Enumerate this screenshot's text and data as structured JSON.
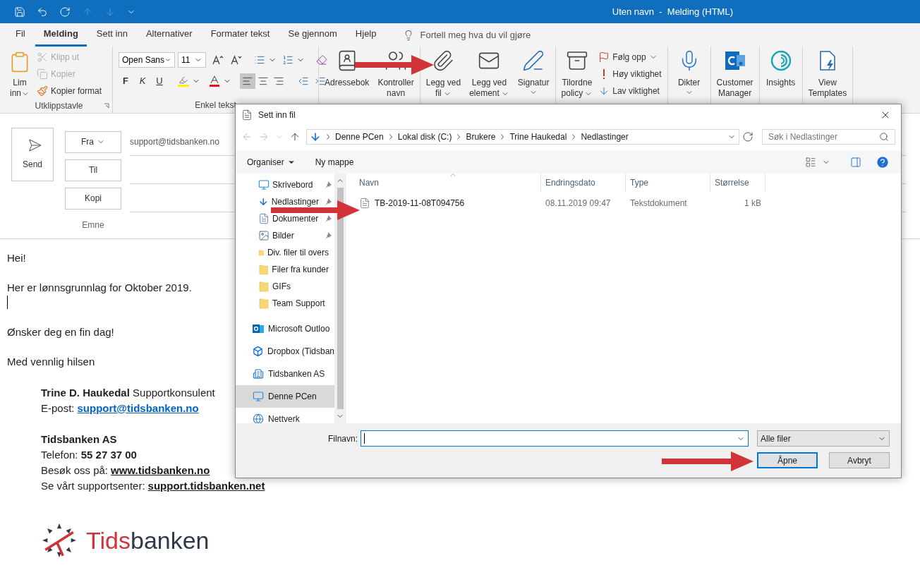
{
  "window": {
    "title": "Uten navn  -  Melding (HTML)"
  },
  "tabs": [
    {
      "label": "Fil",
      "selected": false
    },
    {
      "label": "Melding",
      "selected": true
    },
    {
      "label": "Sett inn",
      "selected": false
    },
    {
      "label": "Alternativer",
      "selected": false
    },
    {
      "label": "Formater tekst",
      "selected": false
    },
    {
      "label": "Se gjennom",
      "selected": false
    },
    {
      "label": "Hjelp",
      "selected": false
    }
  ],
  "tell_me": {
    "placeholder": "Fortell meg hva du vil gjøre"
  },
  "ribbon": {
    "clipboard": {
      "label": "Utklippstavle",
      "paste": {
        "lines": [
          "Lim",
          "inn"
        ],
        "dropdown": true
      },
      "items": [
        {
          "kind": "cut",
          "label": "Klipp ut",
          "disabled": true
        },
        {
          "kind": "copy",
          "label": "Kopier",
          "disabled": true
        },
        {
          "kind": "format",
          "label": "Kopier format",
          "disabled": false
        }
      ]
    },
    "basic_text": {
      "label": "Enkel tekst",
      "font": "Open Sans",
      "size": "11",
      "styles": [
        "F",
        "K",
        "U"
      ],
      "alignments": [
        {
          "kind": "left",
          "selected": true
        },
        {
          "kind": "center",
          "selected": false
        },
        {
          "kind": "right",
          "selected": false
        }
      ]
    },
    "groups": [
      {
        "buttons": [
          {
            "kind": "address-book",
            "lines": [
              "Adressebok"
            ],
            "dropdown": false
          },
          {
            "kind": "check-names",
            "lines": [
              "Kontroller",
              "navn"
            ],
            "dropdown": false
          }
        ]
      },
      {
        "buttons": [
          {
            "kind": "attach-file",
            "lines": [
              "Legg ved",
              "fil"
            ],
            "dropdown": true
          },
          {
            "kind": "attach-item",
            "lines": [
              "Legg ved",
              "element"
            ],
            "dropdown": true
          },
          {
            "kind": "signature",
            "lines": [
              "Signatur"
            ],
            "dropdown": true
          }
        ]
      },
      {
        "buttons": [
          {
            "kind": "policy",
            "lines": [
              "Tilordne",
              "policy"
            ],
            "dropdown": true
          }
        ],
        "small": [
          {
            "kind": "flag",
            "label": "Følg opp",
            "dropdown": true
          },
          {
            "kind": "high",
            "label": "Høy viktighet",
            "dropdown": false
          },
          {
            "kind": "low",
            "label": "Lav viktighet",
            "dropdown": false
          }
        ]
      },
      {
        "buttons": [
          {
            "kind": "dictate",
            "lines": [
              "Dikter"
            ],
            "dropdown": true
          }
        ]
      },
      {
        "buttons": [
          {
            "kind": "customer-manager",
            "lines": [
              "Customer",
              "Manager"
            ],
            "dropdown": false
          }
        ]
      },
      {
        "buttons": [
          {
            "kind": "insights",
            "lines": [
              "Insights"
            ],
            "dropdown": false
          }
        ]
      },
      {
        "buttons": [
          {
            "kind": "templates",
            "lines": [
              "View",
              "Templates"
            ],
            "dropdown": false
          }
        ]
      }
    ]
  },
  "compose": {
    "send": "Send",
    "fields": [
      {
        "label": "Fra",
        "dropdown": true,
        "value": "support@tidsbanken.no"
      },
      {
        "label": "Til",
        "dropdown": false
      },
      {
        "label": "Kopi",
        "dropdown": false
      }
    ],
    "subject_label": "Emne"
  },
  "body": [
    {
      "kind": "text",
      "text": "Hei!"
    },
    {
      "kind": "blank"
    },
    {
      "kind": "text",
      "text": "Her er lønnsgrunnlag for Oktober 2019."
    },
    {
      "kind": "cursor"
    },
    {
      "kind": "blank"
    },
    {
      "kind": "text",
      "text": "Ønsker deg en fin dag!"
    },
    {
      "kind": "blank"
    },
    {
      "kind": "text",
      "text": "Med vennlig hilsen"
    }
  ],
  "signature": [
    {
      "kind": "text",
      "text": "**Trine D. Haukedal** Supportkonsulent"
    },
    {
      "kind": "link",
      "label": "E-post:",
      "link": "support@tidsbanken.no",
      "color": "#0563c1"
    },
    {
      "kind": "blank"
    },
    {
      "kind": "bold",
      "text": "Tidsbanken AS"
    },
    {
      "kind": "text",
      "text": "Telefon: **55 27 37 00**"
    },
    {
      "kind": "link",
      "label": "Besøk oss på:",
      "link": "www.tidsbanken.no",
      "color": "#1a1a1a"
    },
    {
      "kind": "link",
      "label": "Se vårt supportsenter:",
      "link": "support.tidsbanken.net",
      "color": "#1a1a1a"
    }
  ],
  "logo": {
    "parts": [
      {
        "text": "Tids",
        "color": "#d13438"
      },
      {
        "text": "banken",
        "color": "#2e3a48"
      }
    ]
  },
  "dialog": {
    "title": "Sett inn fil",
    "path": [
      "Denne PCen",
      "Lokal disk (C:)",
      "Brukere",
      "Trine Haukedal",
      "Nedlastinger"
    ],
    "search": {
      "placeholder": "Søk i Nedlastinger"
    },
    "toolbar": [
      {
        "label": "Organiser",
        "dropdown": true
      },
      {
        "label": "Ny mappe",
        "dropdown": false
      }
    ],
    "quick_access": [
      {
        "kind": "desktop",
        "label": "Skrivebord",
        "pinned": true
      },
      {
        "kind": "download",
        "label": "Nedlastinger",
        "pinned": true
      },
      {
        "kind": "document",
        "label": "Dokumenter",
        "pinned": true
      },
      {
        "kind": "pictures",
        "label": "Bilder",
        "pinned": true
      },
      {
        "kind": "folder",
        "label": "Div. filer til overs",
        "pinned": false
      },
      {
        "kind": "folder",
        "label": "Filer fra kunder",
        "pinned": false
      },
      {
        "kind": "folder",
        "label": "GIFs",
        "pinned": false
      },
      {
        "kind": "folder",
        "label": "Team Support",
        "pinned": false
      }
    ],
    "locations": [
      {
        "kind": "outlook",
        "label": "Microsoft Outloo",
        "selected": false
      },
      {
        "kind": "dropbox",
        "label": "Dropbox (Tidsban",
        "selected": false
      },
      {
        "kind": "building",
        "label": "Tidsbanken AS",
        "selected": false
      },
      {
        "kind": "pc",
        "label": "Denne PCen",
        "selected": true
      },
      {
        "kind": "network",
        "label": "Nettverk",
        "selected": false
      }
    ],
    "columns": [
      "Navn",
      "Endringsdato",
      "Type",
      "Størrelse"
    ],
    "files": [
      {
        "name": "TB-2019-11-08T094756",
        "date": "08.11.2019 09:47",
        "type": "Tekstdokument",
        "size": "1 kB"
      }
    ],
    "filename_label": "Filnavn:",
    "filetype": "Alle filer",
    "buttons": [
      {
        "label": "Åpne",
        "default": true
      },
      {
        "label": "Avbryt",
        "default": false
      }
    ]
  }
}
